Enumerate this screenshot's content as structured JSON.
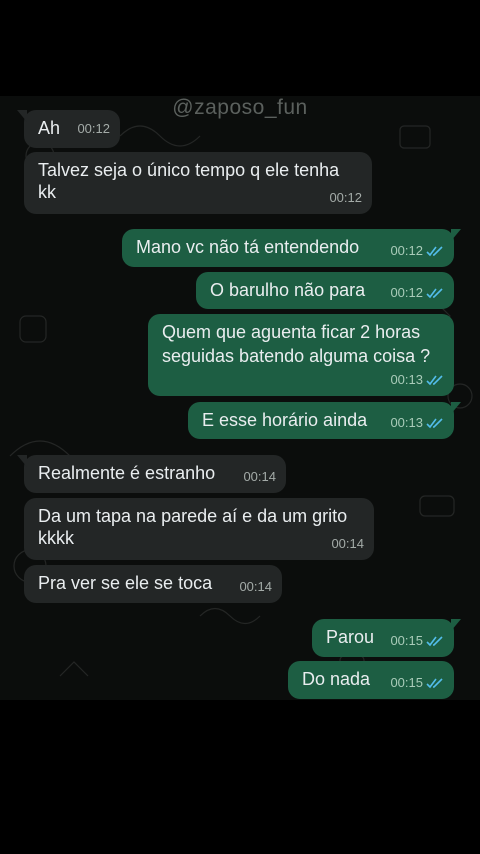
{
  "watermark": "@zaposo_fun",
  "colors": {
    "incoming_bubble": "#232626",
    "outgoing_bubble": "#1d5e43",
    "read_check": "#53bdeb"
  },
  "messages": [
    {
      "direction": "in",
      "text": "Ah",
      "time": "00:12"
    },
    {
      "direction": "in",
      "text": "Talvez seja o único tempo q ele tenha\nkk",
      "time": "00:12"
    },
    {
      "direction": "out",
      "text": "Mano vc não tá entendendo",
      "time": "00:12",
      "status": "read"
    },
    {
      "direction": "out",
      "text": "O barulho não para",
      "time": "00:12",
      "status": "read"
    },
    {
      "direction": "out",
      "text": "Quem que aguenta ficar 2 horas\nseguidas batendo alguma coisa ?",
      "time": "00:13",
      "status": "read"
    },
    {
      "direction": "out",
      "text": "E esse horário ainda",
      "time": "00:13",
      "status": "read"
    },
    {
      "direction": "in",
      "text": "Realmente é estranho",
      "time": "00:14"
    },
    {
      "direction": "in",
      "text": "Da um tapa na parede aí e da um grito\nkkkk",
      "time": "00:14"
    },
    {
      "direction": "in",
      "text": "Pra ver se ele se toca",
      "time": "00:14"
    },
    {
      "direction": "out",
      "text": "Parou",
      "time": "00:15",
      "status": "read"
    },
    {
      "direction": "out",
      "text": "Do nada",
      "time": "00:15",
      "status": "read"
    }
  ]
}
